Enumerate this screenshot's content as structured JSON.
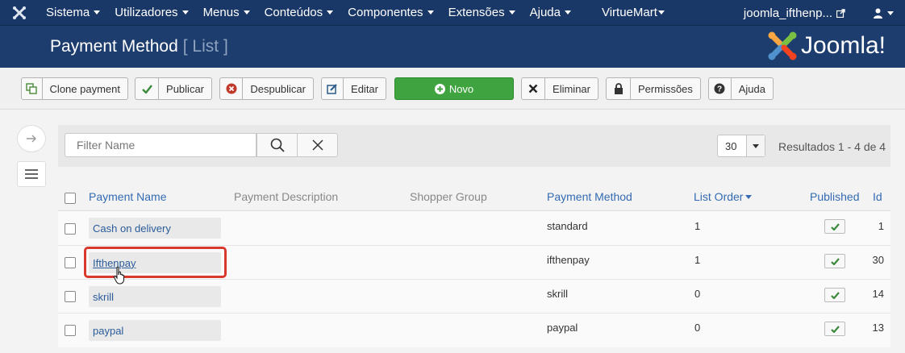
{
  "nav": {
    "items": [
      "Sistema",
      "Utilizadores",
      "Menus",
      "Conteúdos",
      "Componentes",
      "Extensões",
      "Ajuda"
    ],
    "virtuemart": "VirtueMart",
    "site_name": "joomla_ifthenp...",
    "colors": {
      "navbar": "#1a3867",
      "header": "#1c3d6e"
    }
  },
  "header": {
    "title": "Payment Method",
    "subtitle": "[ List ]",
    "brand": "Joomla!"
  },
  "toolbar": {
    "clone": "Clone payment",
    "publish": "Publicar",
    "unpublish": "Despublicar",
    "edit": "Editar",
    "new": "Novo",
    "delete": "Eliminar",
    "permissions": "Permissões",
    "help": "Ajuda",
    "new_color": "#3fa33f"
  },
  "filter": {
    "placeholder": "Filter Name",
    "limit": "30",
    "results": "Resultados 1 - 4 de 4"
  },
  "table": {
    "headers": {
      "name": "Payment Name",
      "description": "Payment Description",
      "shopper_group": "Shopper Group",
      "method": "Payment Method",
      "order": "List Order",
      "published": "Published",
      "id": "Id"
    },
    "rows": [
      {
        "name": "Cash on delivery",
        "method": "standard",
        "order": "1",
        "id": "1"
      },
      {
        "name": "Ifthenpay",
        "method": "ifthenpay",
        "order": "1",
        "id": "30"
      },
      {
        "name": "skrill",
        "method": "skrill",
        "order": "0",
        "id": "14"
      },
      {
        "name": "paypal",
        "method": "paypal",
        "order": "0",
        "id": "13"
      }
    ]
  }
}
